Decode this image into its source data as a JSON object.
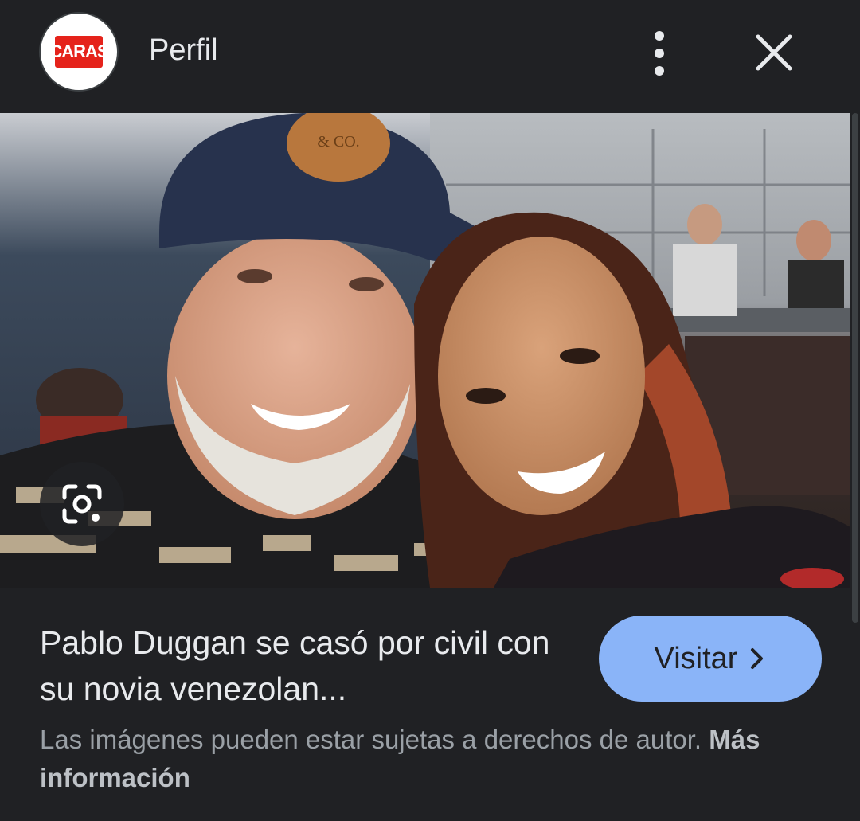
{
  "header": {
    "logo_text": "CARAS",
    "title": "Perfil",
    "more_icon": "more-vert-icon",
    "close_icon": "close-icon"
  },
  "image": {
    "lens_icon": "google-lens-icon",
    "cap_patch_text": "& CO."
  },
  "result": {
    "headline": "Pablo Duggan se casó por civil con su novia venezolan...",
    "visit_label": "Visitar",
    "visit_icon": "chevron-right-icon"
  },
  "footer": {
    "copyright_notice": "Las imágenes pueden estar sujetas a derechos de autor.",
    "more_info_link": "Más información"
  },
  "colors": {
    "background": "#202124",
    "accent_button": "#8ab4f8",
    "brand_red": "#e5231b"
  }
}
